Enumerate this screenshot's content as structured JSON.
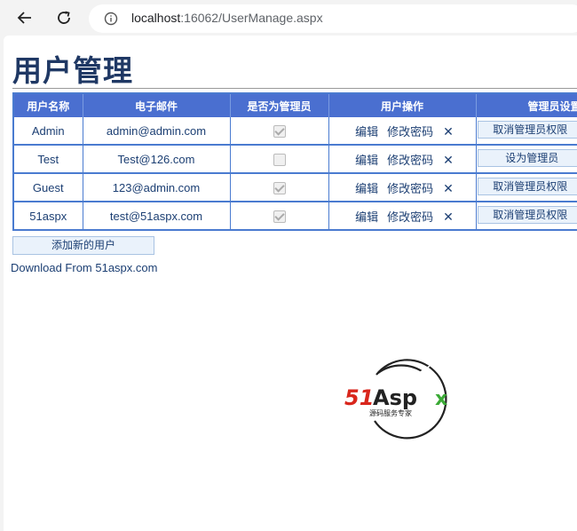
{
  "browser": {
    "url_host": "localhost",
    "url_rest": ":16062/UserManage.aspx"
  },
  "page": {
    "title": "用户管理",
    "table": {
      "headers": [
        "用户名称",
        "电子邮件",
        "是否为管理员",
        "用户操作",
        "管理员设置"
      ],
      "edit_label": "编辑",
      "change_pwd_label": "修改密码",
      "delete_glyph": "✕",
      "rows": [
        {
          "name": "Admin",
          "email": "admin@admin.com",
          "is_admin": true,
          "admin_action": "取消管理员权限"
        },
        {
          "name": "Test",
          "email": "Test@126.com",
          "is_admin": false,
          "admin_action": "设为管理员"
        },
        {
          "name": "Guest",
          "email": "123@admin.com",
          "is_admin": true,
          "admin_action": "取消管理员权限"
        },
        {
          "name": "51aspx",
          "email": "test@51aspx.com",
          "is_admin": true,
          "admin_action": "取消管理员权限"
        }
      ]
    },
    "add_user_label": "添加新的用户",
    "download_text": "Download From 51aspx.com",
    "logo": {
      "brand_51": "51",
      "brand_aspx": "Aspx",
      "tagline": "源码服务专家",
      "colors": {
        "red": "#d9261c",
        "dark": "#222222",
        "green": "#3aa935"
      }
    }
  }
}
